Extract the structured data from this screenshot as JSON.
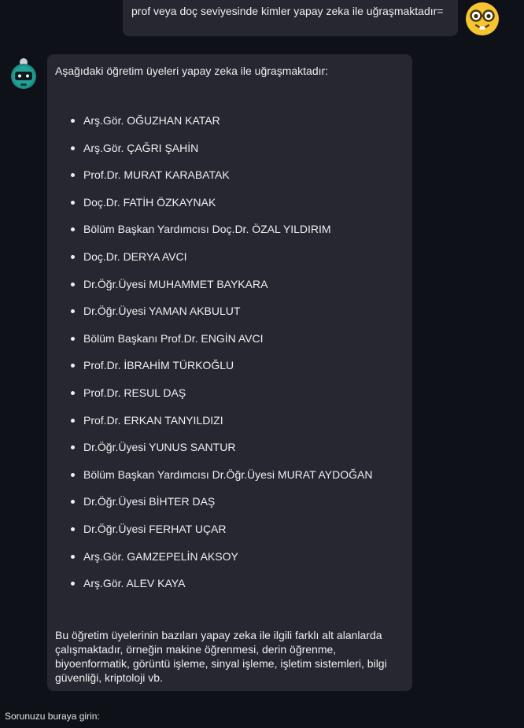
{
  "user_message": {
    "text": "prof veya doç seviyesinde kimler yapay zeka ile uğraşmaktadır=",
    "avatar_icon": "nerd-face-icon"
  },
  "assistant_message": {
    "avatar_icon": "robot-icon",
    "intro": "Aşağıdaki öğretim üyeleri yapay zeka ile uğraşmaktadır:",
    "items": [
      "Arş.Gör. OĞUZHAN KATAR",
      "Arş.Gör. ÇAĞRI ŞAHİN",
      "Prof.Dr. MURAT KARABATAK",
      "Doç.Dr. FATİH ÖZKAYNAK",
      "Bölüm Başkan Yardımcısı Doç.Dr. ÖZAL YILDIRIM",
      "Doç.Dr. DERYA AVCI",
      "Dr.Öğr.Üyesi MUHAMMET BAYKARA",
      "Dr.Öğr.Üyesi YAMAN AKBULUT",
      "Bölüm Başkanı Prof.Dr. ENGİN AVCI",
      "Prof.Dr. İBRAHİM TÜRKOĞLU",
      "Prof.Dr. RESUL DAŞ",
      "Prof.Dr. ERKAN TANYILDIZI",
      "Dr.Öğr.Üyesi YUNUS SANTUR",
      "Bölüm Başkan Yardımcısı Dr.Öğr.Üyesi MURAT AYDOĞAN",
      "Dr.Öğr.Üyesi BİHTER DAŞ",
      "Dr.Öğr.Üyesi FERHAT UÇAR",
      "Arş.Gör. GAMZEPELİN AKSOY",
      "Arş.Gör. ALEV KAYA"
    ],
    "outro": "Bu öğretim üyelerinin bazıları yapay zeka ile ilgili farklı alt alanlarda çalışmaktadır, örneğin makine öğrenmesi, derin öğrenme, biyoenformatik, görüntü işleme, sinyal işleme, işletim sistemleri, bilgi güvenliği, kriptoloji vb."
  },
  "input": {
    "label": "Sorunuzu buraya girin:"
  },
  "colors": {
    "background": "#0e1117",
    "bubble": "#262730",
    "text": "#f0f0f0"
  }
}
